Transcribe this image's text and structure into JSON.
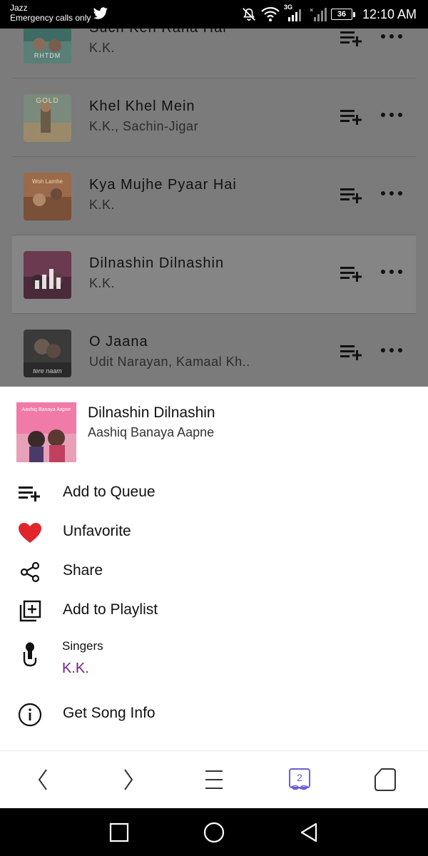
{
  "status_bar": {
    "carrier": "Jazz",
    "emergency": "Emergency calls only",
    "network": "3G",
    "battery": "36",
    "time": "12:10 AM",
    "icons": [
      "twitter-icon",
      "mute-icon",
      "wifi-icon",
      "signal-icon",
      "battery-icon"
    ]
  },
  "song_list": {
    "items": [
      {
        "title": "Such Keh Raha Hai",
        "artist": "K.K.",
        "cover_text": "RHTDM",
        "active": false
      },
      {
        "title": "Khel Khel Mein",
        "artist": "K.K., Sachin-Jigar",
        "cover_text": "GOLD",
        "active": false
      },
      {
        "title": "Kya Mujhe Pyaar Hai",
        "artist": "K.K.",
        "cover_text": "Woh Lamhe",
        "active": false
      },
      {
        "title": "Dilnashin Dilnashin",
        "artist": "K.K.",
        "cover_text": "",
        "active": true
      },
      {
        "title": "O Jaana",
        "artist": "Udit Narayan, Kamaal Kh..",
        "cover_text": "tere naam",
        "active": false
      }
    ]
  },
  "sheet": {
    "title": "Dilnashin Dilnashin",
    "album": "Aashiq Banaya Aapne",
    "cover_text": "Aashiq Banaya Aapne",
    "actions": {
      "add_to_queue": "Add to Queue",
      "unfavorite": "Unfavorite",
      "share": "Share",
      "add_to_playlist": "Add to Playlist",
      "singers_label": "Singers",
      "singers_value": "K.K.",
      "get_song_info": "Get Song Info"
    }
  },
  "browser_nav": {
    "tab_count": "2",
    "icons": [
      "back-icon",
      "forward-icon",
      "menu-icon",
      "tabs-icon",
      "home-icon"
    ]
  },
  "colors": {
    "accent": "#7b1c89",
    "tabs_accent": "#6f5bd6",
    "heart": "#e0262b",
    "dim_overlay": "#7b7b7b"
  }
}
